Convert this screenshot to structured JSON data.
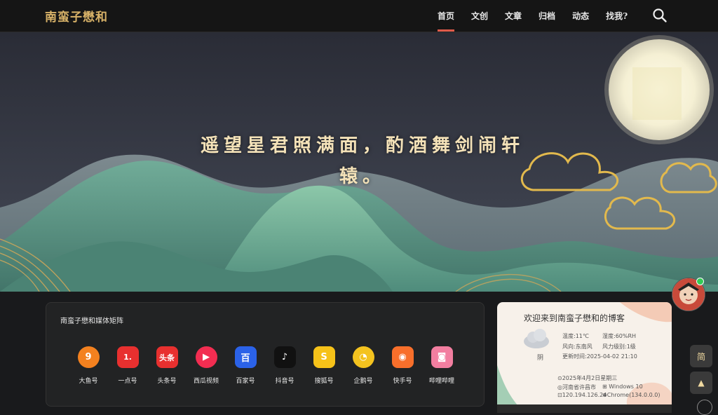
{
  "header": {
    "logo": "南蛮子懋和",
    "nav": [
      "首页",
      "文创",
      "文章",
      "归档",
      "动态",
      "找我?"
    ]
  },
  "hero": {
    "line1": "遥望星君照满面，酌酒舞剑闹轩",
    "line2": "辕。"
  },
  "matrix": {
    "title": "南蛮子懋和媒体矩阵",
    "apps": [
      {
        "label": "大鱼号",
        "glyph": "9",
        "color": "#f3811f",
        "icon": "dayu-icon",
        "round": true
      },
      {
        "label": "一点号",
        "glyph": "1.",
        "color": "#e8302f",
        "icon": "yidian-icon",
        "round": false
      },
      {
        "label": "头条号",
        "glyph": "头条",
        "color": "#e8302f",
        "icon": "toutiao-icon",
        "round": false
      },
      {
        "label": "西瓜视频",
        "glyph": "▶",
        "color": "#f22d51",
        "icon": "xigua-icon",
        "round": true
      },
      {
        "label": "百家号",
        "glyph": "百",
        "color": "#2b62e8",
        "icon": "baijia-icon",
        "round": false
      },
      {
        "label": "抖音号",
        "glyph": "♪",
        "color": "#111111",
        "icon": "douyin-icon",
        "round": false
      },
      {
        "label": "搜狐号",
        "glyph": "S",
        "color": "#f6c219",
        "icon": "sohu-icon",
        "round": false
      },
      {
        "label": "企鹅号",
        "glyph": "◔",
        "color": "#f4c31f",
        "icon": "qie-icon",
        "round": true
      },
      {
        "label": "快手号",
        "glyph": "◉",
        "color": "#f86f2b",
        "icon": "kuaishou-icon",
        "round": false
      },
      {
        "label": "哔哩哔哩",
        "glyph": "◙",
        "color": "#f27ea0",
        "icon": "bilibili-icon",
        "round": false
      }
    ]
  },
  "welcome": {
    "title": "欢迎来到南蛮子懋和的博客",
    "weather_state": "阴",
    "temp": "温度:11℃",
    "humidity": "湿度:60%RH",
    "wind_dir": "风向:东南风",
    "wind_level": "风力级别:1级",
    "updated": "更新时间:2025-04-02 21:10",
    "date": "⊙2025年4月2日星期三",
    "location": "◎河南省许昌市",
    "os": "Windows 10",
    "ip": "120.194.126.24",
    "browser": "Chrome(134.0.0.0)"
  },
  "side": {
    "tool1": "简",
    "tool2": "▲"
  }
}
